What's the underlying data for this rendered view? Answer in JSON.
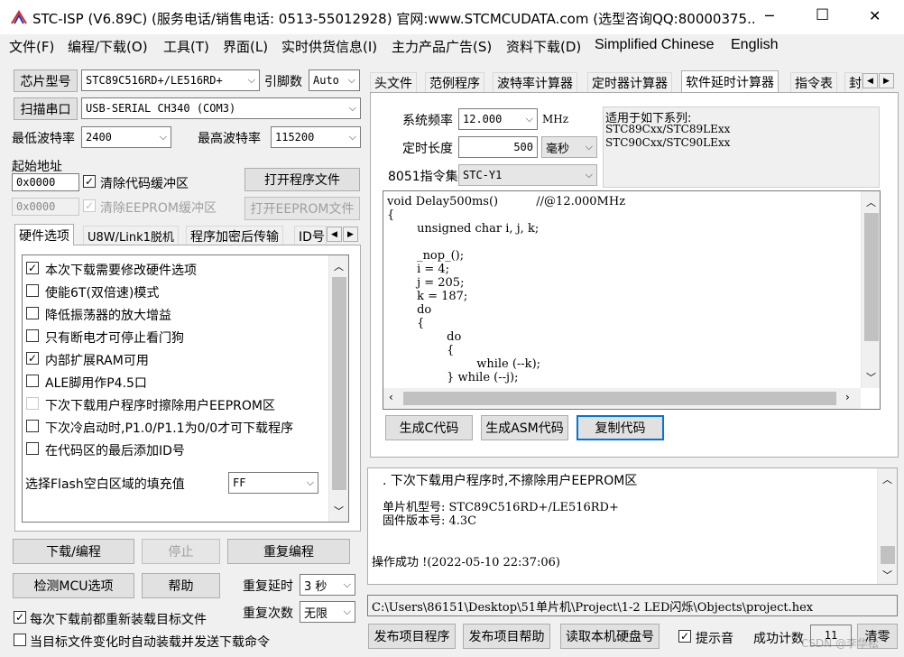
{
  "window": {
    "title": "STC-ISP (V6.89C) (服务电话/销售电话: 0513-55012928) 官网:www.STCMCUDATA.com  (选型咨询QQ:80000375...",
    "minimize_glyph": "─",
    "maximize_glyph": "☐",
    "close_glyph": "✕"
  },
  "menu": [
    "文件(F)",
    "编程/下载(O)",
    "工具(T)",
    "界面(L)",
    "实时供货信息(I)",
    "主力产品广告(S)",
    "资料下载(D)",
    "Simplified Chinese",
    "English"
  ],
  "left": {
    "chip_button": "芯片型号",
    "chip_value": "STC89C516RD+/LE516RD+",
    "pins_label": "引脚数",
    "pins_value": "Auto",
    "scan_button": "扫描串口",
    "port_value": "USB-SERIAL CH340 (COM3)",
    "min_baud_label": "最低波特率",
    "min_baud_value": "2400",
    "max_baud_label": "最高波特率",
    "max_baud_value": "115200",
    "start_addr_label": "起始地址",
    "code_addr": "0x0000",
    "clear_code_label": "清除代码缓冲区",
    "open_program_button": "打开程序文件",
    "eeprom_addr": "0x0000",
    "clear_eeprom_label": "清除EEPROM缓冲区",
    "open_eeprom_button": "打开EEPROM文件",
    "tabs": [
      "硬件选项",
      "U8W/Link1脱机",
      "程序加密后传输",
      "ID号"
    ],
    "hw_options": [
      {
        "label": "本次下载需要修改硬件选项",
        "checked": true,
        "disabled": false
      },
      {
        "label": "使能6T(双倍速)模式",
        "checked": false,
        "disabled": false
      },
      {
        "label": "降低振荡器的放大增益",
        "checked": false,
        "disabled": false
      },
      {
        "label": "只有断电才可停止看门狗",
        "checked": false,
        "disabled": false
      },
      {
        "label": "内部扩展RAM可用",
        "checked": true,
        "disabled": false
      },
      {
        "label": "ALE脚用作P4.5口",
        "checked": false,
        "disabled": false
      },
      {
        "label": "下次下载用户程序时擦除用户EEPROM区",
        "checked": false,
        "disabled": true
      },
      {
        "label": "下次冷启动时,P1.0/P1.1为0/0才可下载程序",
        "checked": false,
        "disabled": false
      },
      {
        "label": "在代码区的最后添加ID号",
        "checked": false,
        "disabled": false
      }
    ],
    "fill_label": "选择Flash空白区域的填充值",
    "fill_value": "FF",
    "download_button": "下载/编程",
    "stop_button": "停止",
    "reprogram_button": "重复编程",
    "detect_button": "检测MCU选项",
    "help_button": "帮助",
    "repeat_delay_label": "重复延时",
    "repeat_delay_value": "3 秒",
    "repeat_count_label": "重复次数",
    "repeat_count_value": "无限",
    "reload_label": "每次下载前都重新装载目标文件",
    "reload_checked": true,
    "autosend_label": "当目标文件变化时自动装载并发送下载命令",
    "autosend_checked": false
  },
  "right": {
    "tabs": [
      "头文件",
      "范例程序",
      "波特率计算器",
      "定时器计算器",
      "软件延时计算器",
      "指令表",
      "封"
    ],
    "freq_label": "系统频率",
    "freq_value": "12.000",
    "freq_unit": "MHz",
    "duration_label": "定时长度",
    "duration_value": "500",
    "duration_unit": "毫秒",
    "isa_label": "8051指令集",
    "isa_value": "STC-Y1",
    "applies_title": "适用于如下系列:",
    "applies_lines": [
      "STC89Cxx/STC89LExx",
      "STC90Cxx/STC90LExx"
    ],
    "code_lines": [
      "void Delay500ms()\t\t//@12.000MHz",
      "{",
      "\tunsigned char i, j, k;",
      "",
      "\t_nop_();",
      "\ti = 4;",
      "\tj = 205;",
      "\tk = 187;",
      "\tdo",
      "\t{",
      "\t\tdo",
      "\t\t{",
      "\t\t\twhile (--k);",
      "\t\t} while (--j);"
    ],
    "gen_c_button": "生成C代码",
    "gen_asm_button": "生成ASM代码",
    "copy_button": "复制代码",
    "log_lines": [
      ". 下次下载用户程序时,不擦除用户EEPROM区",
      "",
      "单片机型号: STC89C516RD+/LE516RD+",
      "固件版本号: 4.3C",
      "",
      "",
      "操作成功 !(2022-05-10 22:37:06)"
    ],
    "file_path": "C:\\Users\\86151\\Desktop\\51单片机\\Project\\1-2 LED闪烁\\Objects\\project.hex",
    "publish_button": "发布项目程序",
    "publish_help_button": "发布项目帮助",
    "read_disk_button": "读取本机硬盘号",
    "prompt_sound_label": "提示音",
    "prompt_sound_checked": true,
    "success_count_label": "成功计数",
    "success_count_value": "11",
    "clear_button": "清零"
  },
  "watermark": "CSDN @李华松"
}
